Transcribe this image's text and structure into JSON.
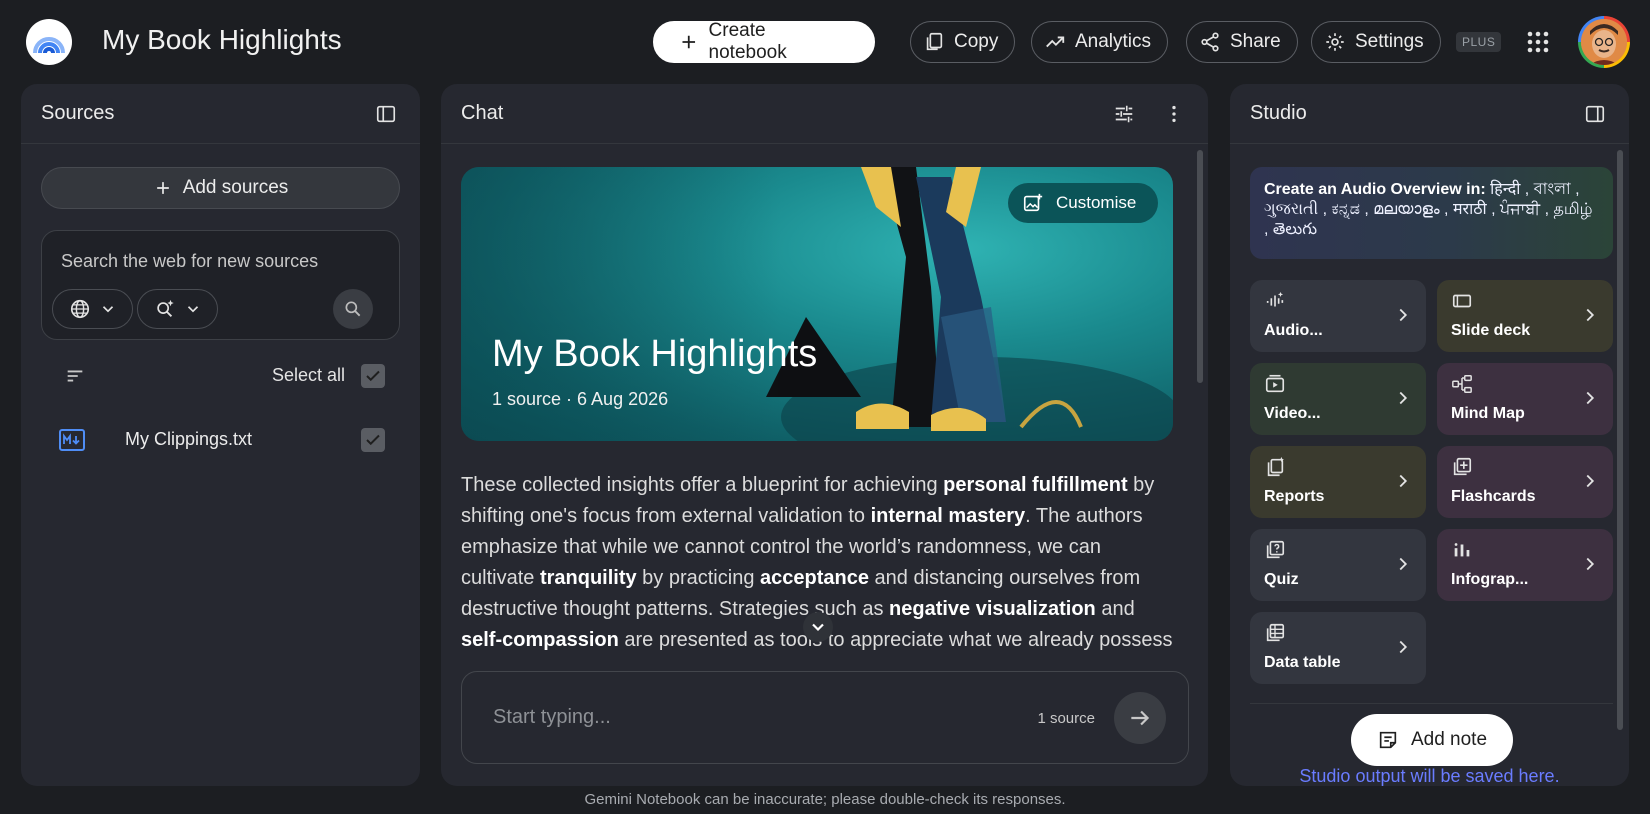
{
  "app": {
    "title": "My Book Highlights"
  },
  "header": {
    "create_notebook": "Create notebook",
    "copy": "Copy",
    "analytics": "Analytics",
    "share": "Share",
    "settings": "Settings",
    "plan_badge": "PLUS"
  },
  "sources": {
    "title": "Sources",
    "add_sources": "Add sources",
    "search_placeholder": "Search the web for new sources",
    "select_all": "Select all",
    "items": [
      {
        "name": "My Clippings.txt",
        "checked": true
      }
    ]
  },
  "chat": {
    "title": "Chat",
    "hero_title": "My Book Highlights",
    "hero_subtitle": "1 source · 6 Aug 2026",
    "customise": "Customise",
    "summary_segments": [
      {
        "text": "These collected insights offer a blueprint for achieving ",
        "bold": false
      },
      {
        "text": "personal fulfillment",
        "bold": true
      },
      {
        "text": " by shifting one's focus from external validation to ",
        "bold": false
      },
      {
        "text": "internal mastery",
        "bold": true
      },
      {
        "text": ". The authors emphasize that while we cannot control the world’s randomness, we can cultivate ",
        "bold": false
      },
      {
        "text": "tranquility",
        "bold": true
      },
      {
        "text": " by practicing ",
        "bold": false
      },
      {
        "text": "acceptance",
        "bold": true
      },
      {
        "text": " and distancing ourselves from destructive thought patterns. Strategies such as ",
        "bold": false
      },
      {
        "text": "negative visualization",
        "bold": true
      },
      {
        "text": " and ",
        "bold": false
      },
      {
        "text": "self-compassion",
        "bold": true
      },
      {
        "text": " are presented as tools to appreciate what we already possess while mitigating the sting of inevitable losses. The",
        "bold": false
      }
    ],
    "input_placeholder": "Start typing...",
    "source_count": "1 source"
  },
  "studio": {
    "title": "Studio",
    "audio_banner_lead": "Create an Audio Overview in:",
    "audio_banner_langs": " हिन्दी , বাংলা , ગુજરાતી , ಕನ್ನಡ , മലയാളം , मराठी , ਪੰਜਾਬੀ , தமிழ் , తెలుగు",
    "tiles": [
      {
        "label": "Audio...",
        "icon": "audio-waveform-icon",
        "color": "#33363f"
      },
      {
        "label": "Slide deck",
        "icon": "slides-icon",
        "color": "#3a3a2e"
      },
      {
        "label": "Video...",
        "icon": "video-icon",
        "color": "#2f3a32"
      },
      {
        "label": "Mind Map",
        "icon": "mind-map-icon",
        "color": "#3d3040"
      },
      {
        "label": "Reports",
        "icon": "reports-icon",
        "color": "#3a3a2e"
      },
      {
        "label": "Flashcards",
        "icon": "flashcards-icon",
        "color": "#3d3040"
      },
      {
        "label": "Quiz",
        "icon": "quiz-icon",
        "color": "#33363f"
      },
      {
        "label": "Infograp...",
        "icon": "infographic-icon",
        "color": "#3d3040"
      },
      {
        "label": "Data table",
        "icon": "data-table-icon",
        "color": "#33363f"
      }
    ],
    "add_note": "Add note",
    "output_hint": "Studio output will be saved here."
  },
  "footer": {
    "disclaimer": "Gemini Notebook can be inaccurate; please double-check its responses."
  }
}
